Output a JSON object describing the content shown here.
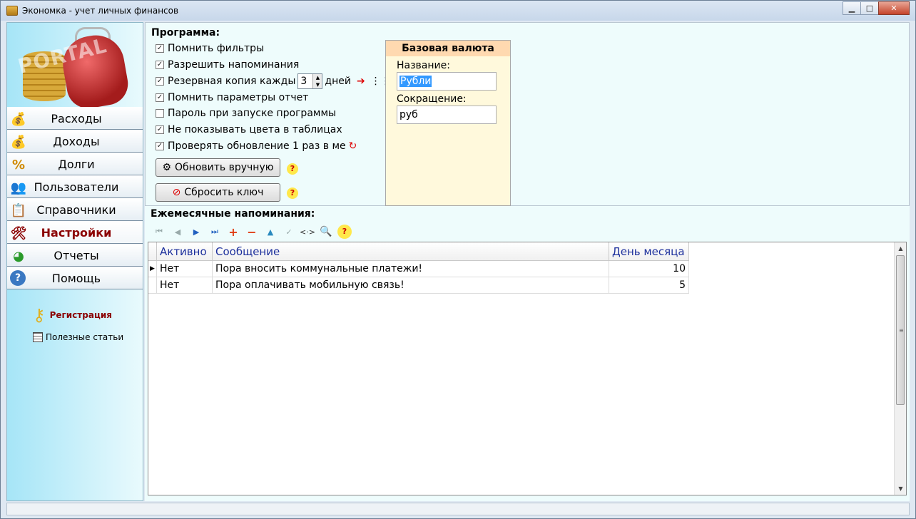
{
  "window": {
    "title": "Экономка - учет личных финансов",
    "controls": {
      "minimize": "▁",
      "maximize": "□",
      "close": "✕"
    }
  },
  "logo": {
    "watermark": "PORTAL"
  },
  "sidebar": {
    "items": [
      {
        "label": "Расходы",
        "icon": "expense-coins-icon",
        "glyph": "💰"
      },
      {
        "label": "Доходы",
        "icon": "income-coins-icon",
        "glyph": "💰"
      },
      {
        "label": "Долги",
        "icon": "percent-icon",
        "glyph": "%"
      },
      {
        "label": "Пользователи",
        "icon": "users-icon",
        "glyph": "👥"
      },
      {
        "label": "Справочники",
        "icon": "reference-book-icon",
        "glyph": "📋"
      },
      {
        "label": "Настройки",
        "icon": "tools-icon",
        "glyph": "🛠",
        "active": true
      },
      {
        "label": "Отчеты",
        "icon": "pie-chart-icon",
        "glyph": "◕"
      },
      {
        "label": "Помощь",
        "icon": "help-circle-icon",
        "glyph": "?"
      }
    ],
    "registration": "Регистрация",
    "articles": "Полезные статьи"
  },
  "program": {
    "title": "Программа:",
    "options": [
      {
        "label": "Помнить фильтры",
        "checked": true
      },
      {
        "label": "Разрешить напоминания",
        "checked": true
      },
      {
        "label": "Резервная копия кажды",
        "checked": true
      },
      {
        "label": "Помнить параметры отчет",
        "checked": true
      },
      {
        "label": "Пароль при запуске программы",
        "checked": false
      },
      {
        "label": "Не показывать цвета в таблицах",
        "checked": true
      },
      {
        "label": "Проверять обновление 1 раз в ме",
        "checked": true
      }
    ],
    "backup_days": "3",
    "backup_days_suffix": "дней",
    "update_button": "Обновить вручную",
    "reset_button": "Сбросить ключ"
  },
  "currency": {
    "title": "Базовая валюта",
    "name_label": "Название:",
    "name_value": "Рубли",
    "abbr_label": "Сокращение:",
    "abbr_value": "руб"
  },
  "reminders": {
    "title": "Ежемесячные напоминания:",
    "columns": [
      "Активно",
      "Сообщение",
      "День месяца"
    ],
    "rows": [
      {
        "active": "Нет",
        "message": "Пора вносить коммунальные платежи!",
        "day": "10"
      },
      {
        "active": "Нет",
        "message": "Пора оплачивать мобильную связь!",
        "day": "5"
      }
    ]
  },
  "colors": {
    "active_nav": "#8b0000",
    "grid_header_text": "#1c2f9c",
    "currency_header": "#ffd9b0",
    "currency_panel": "#fff9dc"
  }
}
